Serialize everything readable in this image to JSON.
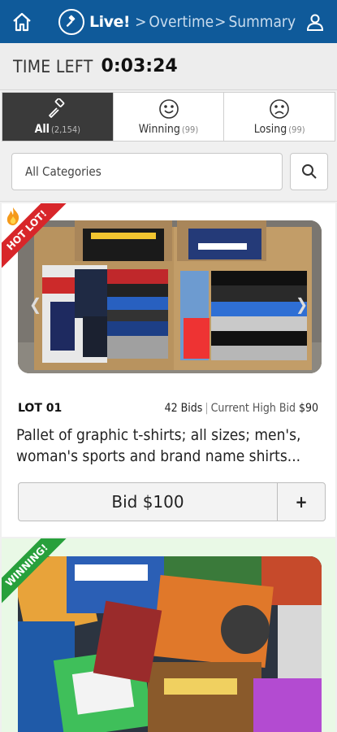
{
  "nav": {
    "breadcrumbs": [
      "Live!",
      "Overtime",
      "Summary"
    ],
    "separator": ">",
    "icons": {
      "home": "home-icon",
      "gavel": "gavel-icon",
      "user": "user-icon"
    }
  },
  "timer": {
    "label": "TIME LEFT",
    "value": "0:03:24"
  },
  "filters": [
    {
      "label": "All",
      "count": "(2,154)",
      "icon": "gavel-icon",
      "active": true
    },
    {
      "label": "Winning",
      "count": "(99)",
      "icon": "smile-icon",
      "active": false
    },
    {
      "label": "Losing",
      "count": "(99)",
      "icon": "frown-icon",
      "active": false
    }
  ],
  "category": {
    "selected": "All Categories",
    "search_icon": "search-icon"
  },
  "lots": [
    {
      "ribbon": "HOT LOT!",
      "number": "LOT 01",
      "bids": "42 Bids",
      "high_bid_label": "Current High Bid",
      "high_bid": "$90",
      "title": "Pallet of graphic t-shirts; all sizes; men's, woman's sports and brand name shirts...",
      "bid_button": "Bid $100",
      "plus_label": "+"
    },
    {
      "ribbon": "WINNING!"
    }
  ],
  "colors": {
    "header": "#0f5a9a",
    "hot": "#d8262a",
    "winning": "#28a03c",
    "active_tab": "#3a3a3a"
  }
}
